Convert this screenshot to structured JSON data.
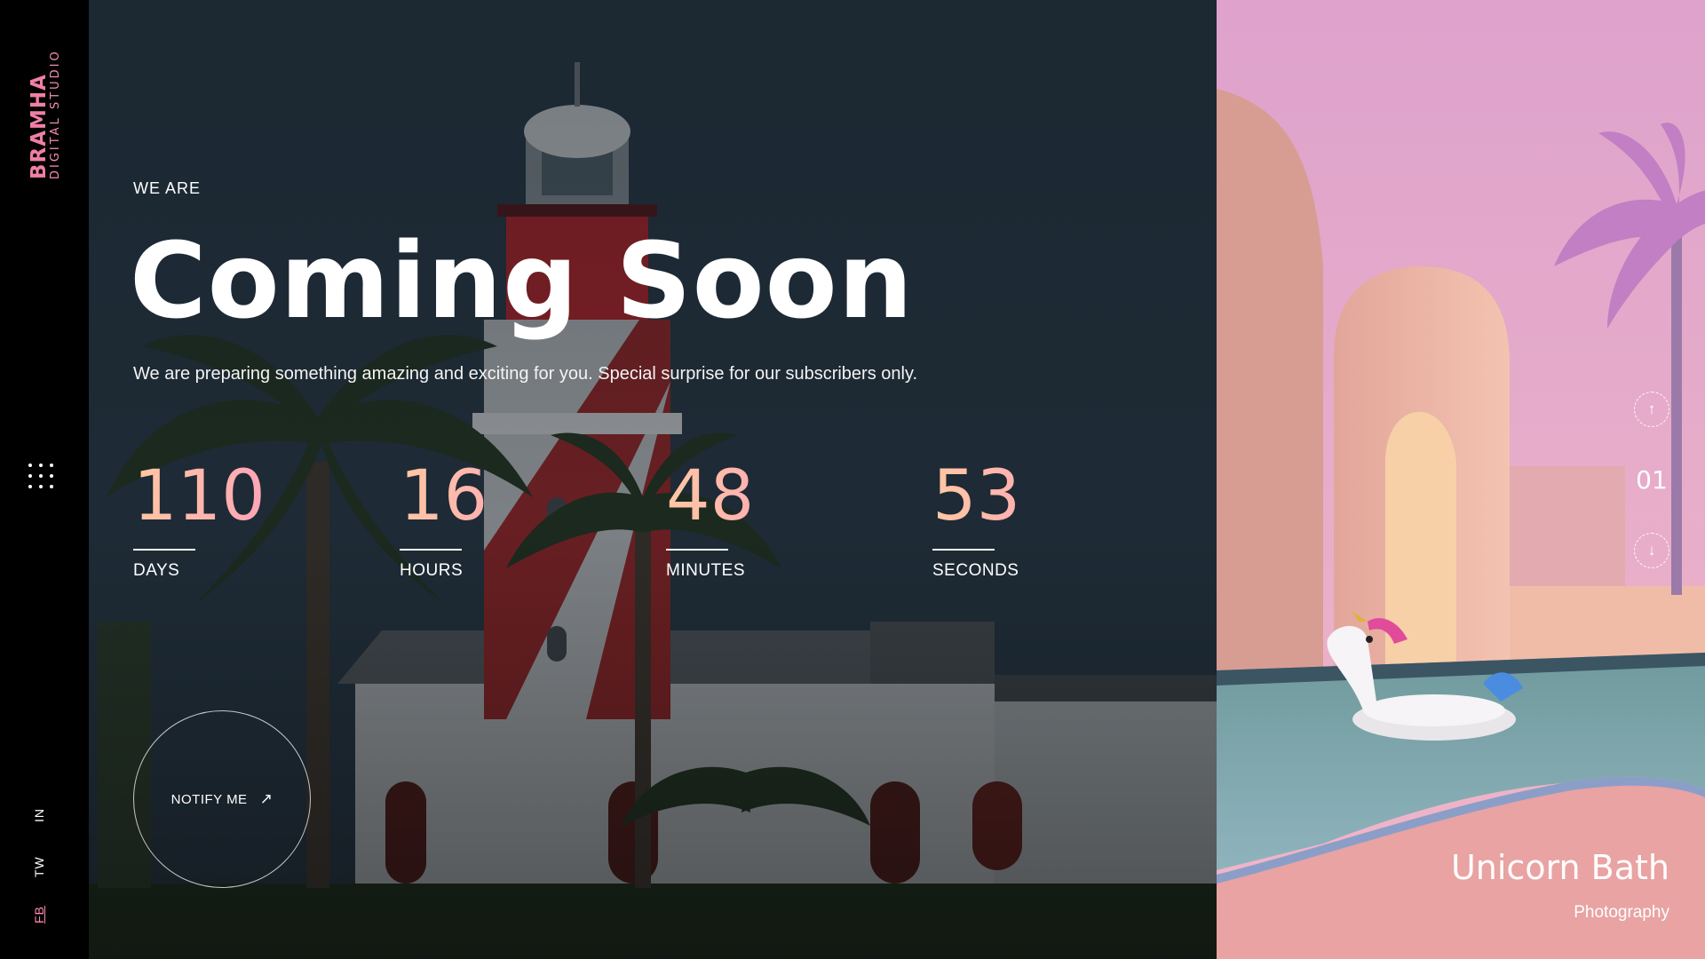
{
  "brand": {
    "name": "BRAMHA",
    "tagline": "DIGITAL STUDIO"
  },
  "sidebar": {
    "menu_icon": "grid-dots-icon",
    "social": [
      {
        "label": "IN"
      },
      {
        "label": "TW"
      },
      {
        "label": "FB"
      }
    ]
  },
  "hero": {
    "eyebrow": "WE ARE",
    "title": "Coming Soon",
    "subtitle": "We are preparing something amazing and exciting for you. Special surprise for our subscribers only.",
    "countdown": [
      {
        "value": "110",
        "label": "DAYS"
      },
      {
        "value": "16",
        "label": "HOURS"
      },
      {
        "value": "48",
        "label": "MINUTES"
      },
      {
        "value": "53",
        "label": "SECONDS"
      }
    ],
    "notify_label": "NOTIFY ME",
    "notify_icon": "arrow-up-right-icon"
  },
  "panel": {
    "slide_number": "01",
    "up_icon": "arrow-up-icon",
    "down_icon": "arrow-down-icon",
    "project_title": "Unicorn Bath",
    "project_category": "Photography"
  },
  "colors": {
    "accent_pink": "#ff8ab1",
    "gradient_start": "#ffc8a4",
    "gradient_end": "#ff8bc4",
    "sidebar_bg": "#000000"
  }
}
